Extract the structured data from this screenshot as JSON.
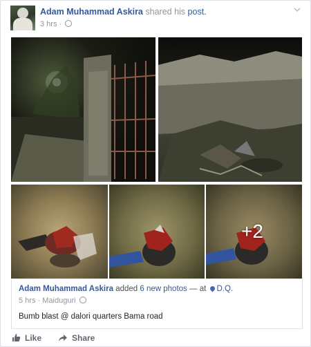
{
  "post": {
    "author": "Adam Muhammad Askira",
    "action_text": "shared his",
    "post_link": "post.",
    "time": "3 hrs",
    "separator": "·"
  },
  "shared": {
    "author": "Adam Muhammad Askira",
    "action_text": "added",
    "photos_link": "6 new photos",
    "at_text": "— at",
    "location": "D.Q.",
    "time": "5 hrs",
    "separator": "·",
    "place": "Maiduguri",
    "caption": "Bumb blast @ dalori quarters Bama road"
  },
  "gallery": {
    "more_count": "+2"
  },
  "actions": {
    "like": "Like",
    "share": "Share"
  },
  "colors": {
    "link": "#365899",
    "meta": "#90949c"
  },
  "icons": {
    "privacy": "globe-icon",
    "menu": "chevron-down-icon",
    "location": "map-pin-icon",
    "like": "thumbs-up-icon",
    "share": "share-arrow-icon"
  }
}
